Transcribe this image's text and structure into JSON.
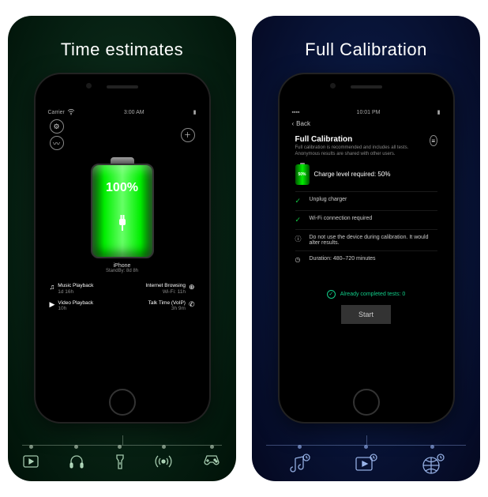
{
  "left": {
    "title": "Time estimates",
    "status": {
      "carrier": "Carrier",
      "time": "3:00 AM"
    },
    "battery_pct": "100%",
    "device": "iPhone",
    "standby_label": "StandBy:",
    "standby_val": "8d 8h",
    "items": [
      {
        "label": "Music Playback",
        "value": "1d 16h"
      },
      {
        "label": "Internet Browsing",
        "value": "Wi-Fi: 11h"
      },
      {
        "label": "Video Playback",
        "value": "10h"
      },
      {
        "label": "Talk Time (VoIP)",
        "value": "3h 9m"
      }
    ],
    "footer_icons": [
      "video-icon",
      "headphones-icon",
      "flashlight-icon",
      "hotspot-icon",
      "gamepad-icon"
    ]
  },
  "right": {
    "title": "Full Calibration",
    "status_time": "10:01 PM",
    "back": "Back",
    "heading": "Full Calibration",
    "desc": "Full calibration is recommended and includes all tests. Anonymous results are shared with other users.",
    "req_badge": "50%",
    "req_text": "Charge level required: 50%",
    "rows": [
      {
        "icon": "check",
        "text": "Unplug charger"
      },
      {
        "icon": "check",
        "text": "Wi-Fi connection required"
      },
      {
        "icon": "info",
        "text": "Do not use the device during calibration. It would alter results."
      },
      {
        "icon": "clock",
        "text": "Duration: 480–720 minutes"
      }
    ],
    "completed": "Already completed tests: 0",
    "start": "Start",
    "footer_icons": [
      "music-clock-icon",
      "video-clock-icon",
      "globe-clock-icon"
    ]
  }
}
